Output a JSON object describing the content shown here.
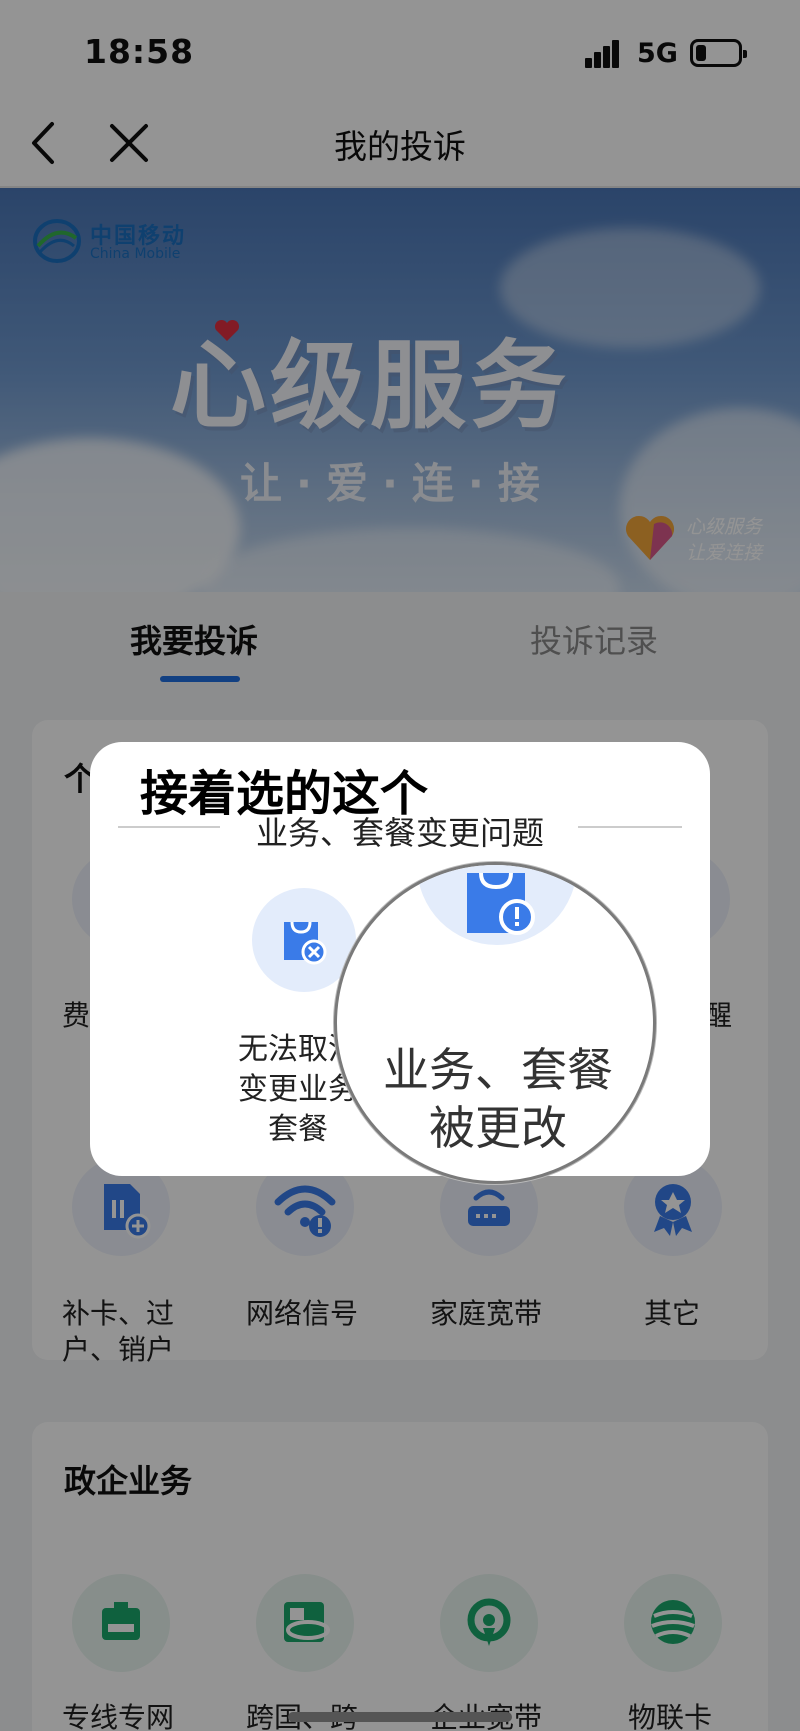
{
  "status_bar": {
    "time": "18:58",
    "network": "5G"
  },
  "nav": {
    "title": "我的投诉"
  },
  "banner": {
    "brand_cn": "中国移动",
    "brand_en": "China Mobile",
    "slogan": "心级服务",
    "subslogan": "让·爱·连·接",
    "badge_line1": "心级服务",
    "badge_line2": "让爱连接"
  },
  "tabs": [
    {
      "label": "我要投诉",
      "active": true
    },
    {
      "label": "投诉记录",
      "active": false
    }
  ],
  "personal": {
    "heading": "个",
    "partial_left": "费",
    "partial_right": "醒",
    "items": [
      {
        "line1": "补卡、过",
        "line2": "户、销户",
        "icon": "sim-card-add-icon"
      },
      {
        "line1": "网络信号",
        "line2": "",
        "icon": "wifi-alert-icon"
      },
      {
        "line1": "家庭宽带",
        "line2": "",
        "icon": "router-icon"
      },
      {
        "line1": "其它",
        "line2": "",
        "icon": "award-badge-icon"
      }
    ]
  },
  "gov": {
    "heading": "政企业务",
    "items": [
      {
        "label": "专线专网",
        "icon": "dedicated-line-icon"
      },
      {
        "label": "跨国、跨",
        "icon": "cross-border-icon"
      },
      {
        "label": "企业宽带",
        "icon": "enterprise-broadband-icon"
      },
      {
        "label": "物联卡",
        "icon": "iot-card-icon"
      }
    ]
  },
  "tip": {
    "title": "接着选的这个",
    "subtitle": "业务、套餐变更问题",
    "option_line1": "无法取消",
    "option_line2": "变更业务",
    "option_line3": "套餐",
    "magnified_line1": "业务、套餐",
    "magnified_line2": "被更改"
  },
  "colors": {
    "accent": "#1f6fe0",
    "icon_blue": "#3a7be8",
    "icon_green": "#1aa86b"
  }
}
